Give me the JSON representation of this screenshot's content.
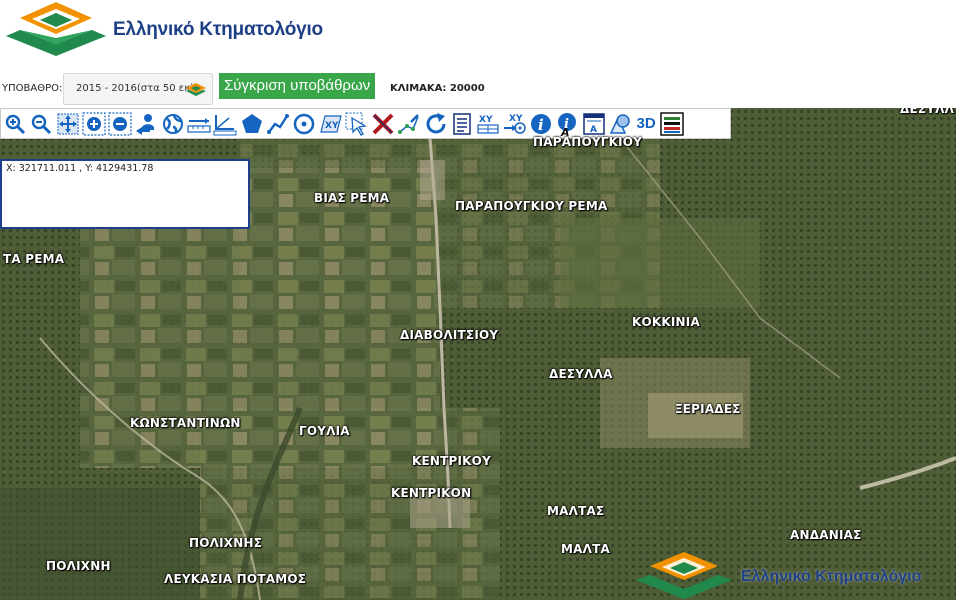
{
  "header": {
    "title": "Ελληνικό Κτηματολόγιο"
  },
  "basemap": {
    "label": "ΥΠΟΒΑΘΡΟ:",
    "selected": "2015 - 2016(στα 50 εκ)",
    "compare_label": "Σύγκριση υποβάθρων",
    "scale": "ΚΛΙΜΑΚΑ: 20000"
  },
  "toolbar": {
    "tools": [
      "zoom-in-icon",
      "zoom-out-icon",
      "pan-icon",
      "zoom-box-in-icon",
      "zoom-box-out-icon",
      "previous-extent-icon",
      "globe-icon",
      "measure-distance-icon",
      "measure-angle-icon",
      "polygon-icon",
      "polyline-icon",
      "circle-icon",
      "xy-point-icon",
      "select-arrow-icon",
      "clear-icon",
      "edit-vertices-icon",
      "refresh-icon",
      "list-icon",
      "xy-table-icon",
      "xy-goto-icon",
      "info-icon",
      "info-text-icon",
      "label-icon",
      "shape-icon",
      "3d-icon",
      "legend-icon"
    ],
    "three_d_label": "3D"
  },
  "coordinates": {
    "text": "X: 321711.011 , Y: 4129431.78"
  },
  "places": [
    "ΔΕΣΥΛΛ",
    "ΠΑΡΑΠΟΥΓΚΙΟΥ",
    "ΒΙΑΣ ΡΕΜΑ",
    "ΠΑΡΑΠΟΥΓΚΙΟΥ ΡΕΜΑ",
    "ΤΑ ΡΕΜΑ",
    "ΔΙΑΒΟΛΙΤΣΙΟΥ",
    "ΚΟΚΚΙΝΙΑ",
    "ΔΕΣΥΛΛΑ",
    "ΞΕΡΙΑΔΕΣ",
    "ΚΩΝΣΤΑΝΤΙΝΩΝ",
    "ΓΟΥΛΙΑ",
    "ΚΕΝΤΡΙΚΟΥ",
    "ΚΕΝΤΡΙΚΟΝ",
    "ΜΑΛΤΑΣ",
    "ΑΝΔΑΝΙΑΣ",
    "ΠΟΛΙΧΝΗΣ",
    "ΜΑΛΤΑ",
    "ΠΟΛΙΧΝΗ",
    "ΛΕΥΚΑΣΙΑ ΠΟΤΑΜΟΣ"
  ],
  "watermark": {
    "title": "Ελληνικό Κτηματολόγιο"
  },
  "colors": {
    "brand_blue": "#1d3f86",
    "brand_green": "#1f8a4c",
    "brand_orange": "#f39200",
    "compare_green": "#3aa64a",
    "tool_blue": "#1565c0"
  }
}
